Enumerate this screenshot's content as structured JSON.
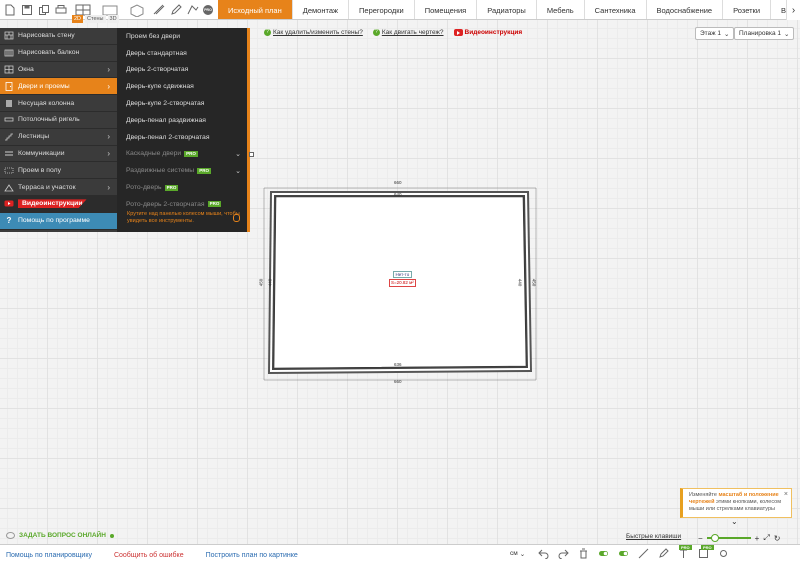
{
  "toolbar": {
    "view_tags": [
      "2D",
      "Стены",
      "3D"
    ],
    "pro_badge": "PRO"
  },
  "tabs": [
    "Исходный план",
    "Демонтаж",
    "Перегородки",
    "Помещения",
    "Радиаторы",
    "Мебель",
    "Сантехника",
    "Водоснабжение",
    "Розетки",
    "Выключатели"
  ],
  "active_tab": "Исходный план",
  "help_links": [
    {
      "label": "Как удалить/изменить стены?",
      "icon": "question-icon"
    },
    {
      "label": "Как двигать чертеж?",
      "icon": "question-icon"
    },
    {
      "label": "Видеоинструкция",
      "icon": "youtube-icon"
    }
  ],
  "floor_select": "Этаж 1",
  "layout_select": "Планировка 1",
  "left_menu": [
    {
      "label": "Нарисовать стену",
      "icon": "wall-icon",
      "arrow": false
    },
    {
      "label": "Нарисовать балкон",
      "icon": "balcony-icon",
      "arrow": false
    },
    {
      "label": "Окна",
      "icon": "window-icon",
      "arrow": true
    },
    {
      "label": "Двери и проемы",
      "icon": "door-icon",
      "arrow": true,
      "active": true
    },
    {
      "label": "Несущая колонна",
      "icon": "column-icon",
      "arrow": false
    },
    {
      "label": "Потолочный ригель",
      "icon": "beam-icon",
      "arrow": false
    },
    {
      "label": "Лестницы",
      "icon": "stairs-icon",
      "arrow": true
    },
    {
      "label": "Коммуникации",
      "icon": "pipes-icon",
      "arrow": true
    },
    {
      "label": "Проем в полу",
      "icon": "floor-opening-icon",
      "arrow": false
    },
    {
      "label": "Терраса и участок",
      "icon": "terrace-icon",
      "arrow": true
    },
    {
      "label": "Видеоинструкции",
      "icon": "youtube-icon",
      "arrow": false
    },
    {
      "label": "Помощь по программе",
      "icon": "help-icon",
      "arrow": false
    }
  ],
  "submenu": [
    {
      "label": "Проем без двери",
      "dim": false
    },
    {
      "label": "Дверь стандартная",
      "dim": false
    },
    {
      "label": "Дверь 2-створчатая",
      "dim": false
    },
    {
      "label": "Дверь-купе сдвижная",
      "dim": false
    },
    {
      "label": "Дверь-купе 2-створчатая",
      "dim": false
    },
    {
      "label": "Дверь-пенал раздвижная",
      "dim": false
    },
    {
      "label": "Дверь-пенал 2-створчатая",
      "dim": false
    },
    {
      "label": "Каскадные двери",
      "dim": true,
      "pro": true,
      "chev": true
    },
    {
      "label": "Раздвижные системы",
      "dim": true,
      "pro": true,
      "chev": true
    },
    {
      "label": "Рото-дверь",
      "dim": true,
      "pro": true,
      "chev": false
    },
    {
      "label": "Рото-дверь 2-створчатая",
      "dim": true,
      "pro": true,
      "chev": false
    }
  ],
  "submenu_tip": "Крутите над панелью колесом мыши, чтобы увидеть все инструменты.",
  "plan": {
    "dim_top_outer": "660",
    "dim_top_inner": "640",
    "dim_bottom_inner": "636",
    "dim_bottom_outer": "660",
    "dim_left_outer": "450",
    "dim_left_inner": "440",
    "dim_right_inner": "440",
    "dim_right_outer": "450",
    "room_name": "Нет-то",
    "room_area": "S=20.82 м²"
  },
  "notice": {
    "pre": "Изменяйте ",
    "bold": "масштаб и положение чертежей",
    "post": " этими кнопками, колесом мыши или стрелками клавиатуры",
    "close": "×"
  },
  "ask_online": "ЗАДАТЬ ВОПРОС ОНЛАЙН",
  "hotkeys": "Быстрые клавиши",
  "bottom_links": [
    "Помощь по планировщику",
    "Сообщить об ошибке",
    "Построить план по картинке"
  ],
  "unit": "см",
  "unit_arrow": "⌄",
  "colors": {
    "accent": "#e7831a",
    "green": "#5aa82a",
    "help_blue": "#3d8bb5",
    "video_red": "#d22"
  }
}
